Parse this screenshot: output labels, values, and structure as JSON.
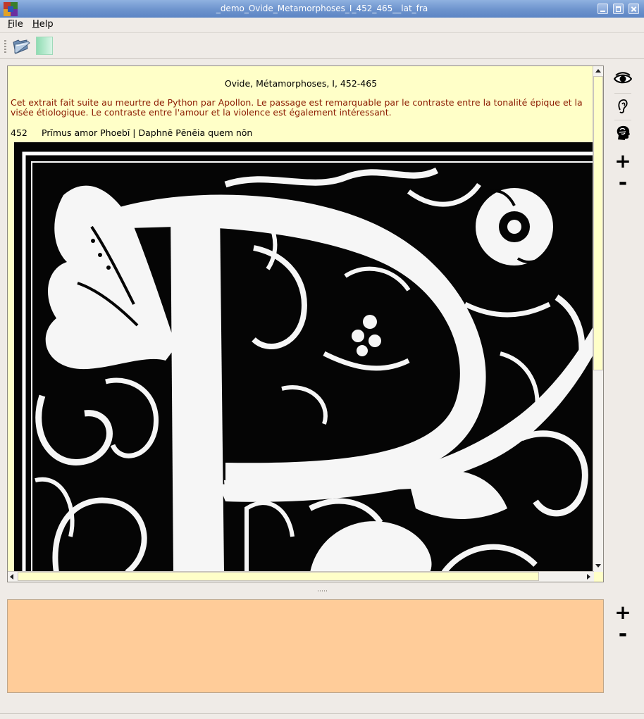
{
  "window": {
    "title": "_demo_Ovide_Metamorphoses_I_452_465__lat_fra",
    "icon": "app-grid-icon",
    "controls": [
      "minimize-icon",
      "maximize-icon",
      "close-icon"
    ]
  },
  "menu": {
    "file": {
      "key": "F",
      "rest": "ile"
    },
    "help": {
      "key": "H",
      "rest": "elp"
    }
  },
  "toolbar": {
    "buttons": [
      {
        "name": "open-folder-icon"
      },
      {
        "name": "gradient-color-icon"
      }
    ]
  },
  "document": {
    "title": "Ovide, Métamorphoses, I, 452-465",
    "intro": "Cet extrait fait suite au meurtre de Python par Apollon. Le passage est remarquable par le contraste entre la tonalité épique et la visée étiologique. Le contraste entre l'amour et la violence est également intéressant.",
    "verse_number": "452",
    "verse_text": "Prīmus amor Phoebī | Daphnē Pēnēia quem nōn",
    "image": "decorated initial letter P with floral ornament"
  },
  "side_tools_top": [
    "eye-icon",
    "ear-icon",
    "head-brain-icon",
    "zoom-in-icon",
    "zoom-out-icon"
  ],
  "side_tools_bottom": [
    "zoom-in-icon",
    "zoom-out-icon"
  ],
  "colors": {
    "text_panel_bg": "#ffffc8",
    "intro_text": "#8b1a00",
    "lower_panel_bg": "#ffcc99",
    "titlebar": "#6d93cd"
  }
}
